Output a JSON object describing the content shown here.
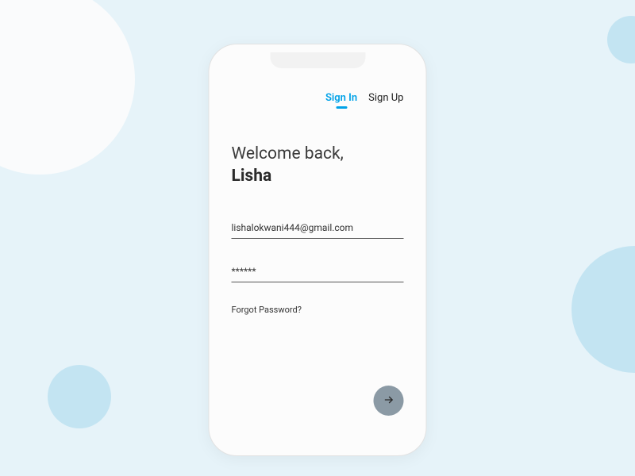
{
  "tabs": {
    "signIn": "Sign In",
    "signUp": "Sign Up"
  },
  "greeting": "Welcome back,",
  "username": "Lisha",
  "form": {
    "emailValue": "lishalokwani444@gmail.com",
    "passwordValue": "******",
    "forgot": "Forgot Password?"
  }
}
